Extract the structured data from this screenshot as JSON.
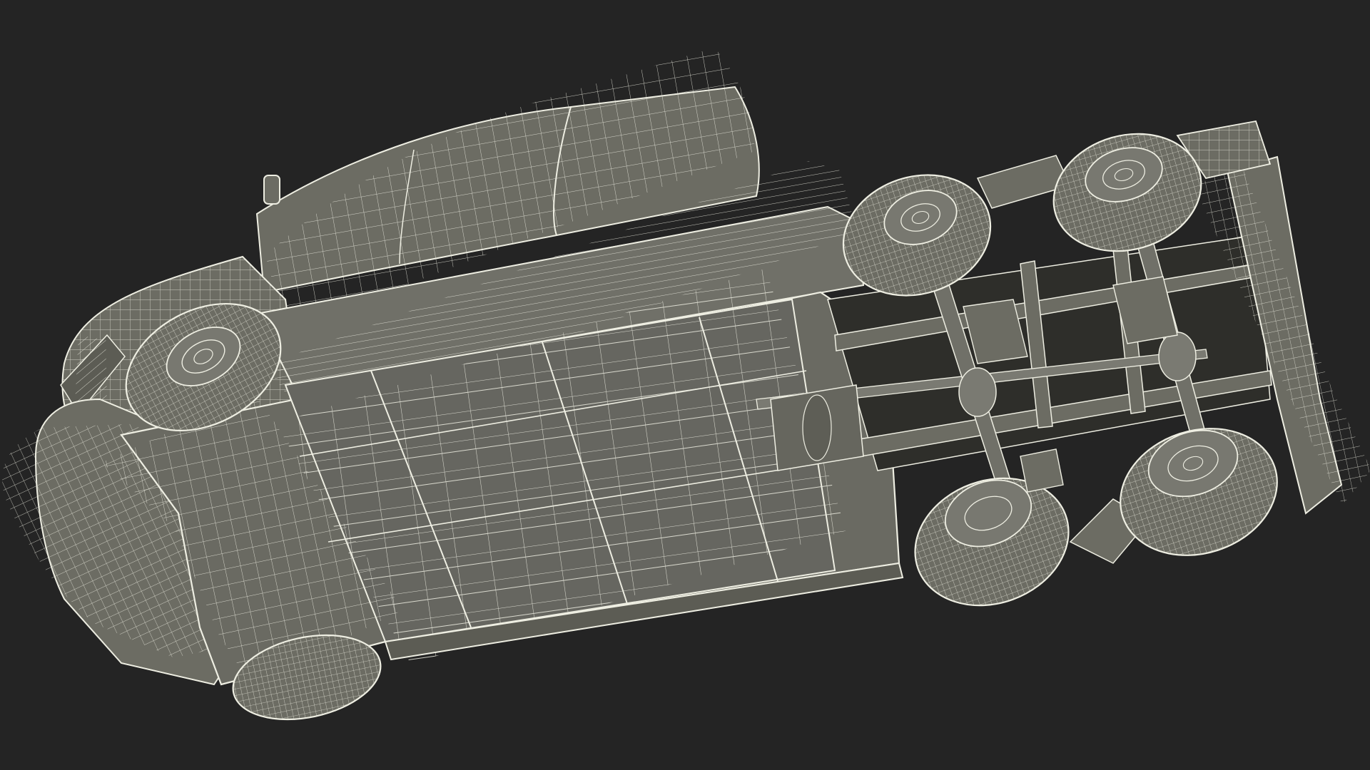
{
  "scene": {
    "background": "#242424",
    "body_fill": "#6c6c63",
    "body_fill_light": "#787870",
    "body_fill_dark": "#5c5c54",
    "wire_color": "#eeeee2",
    "wire_color_dim": "#cfcfc2",
    "shadow_color": "#3e3e38",
    "subject": "semi-truck-tractor-wireframe-underside"
  }
}
